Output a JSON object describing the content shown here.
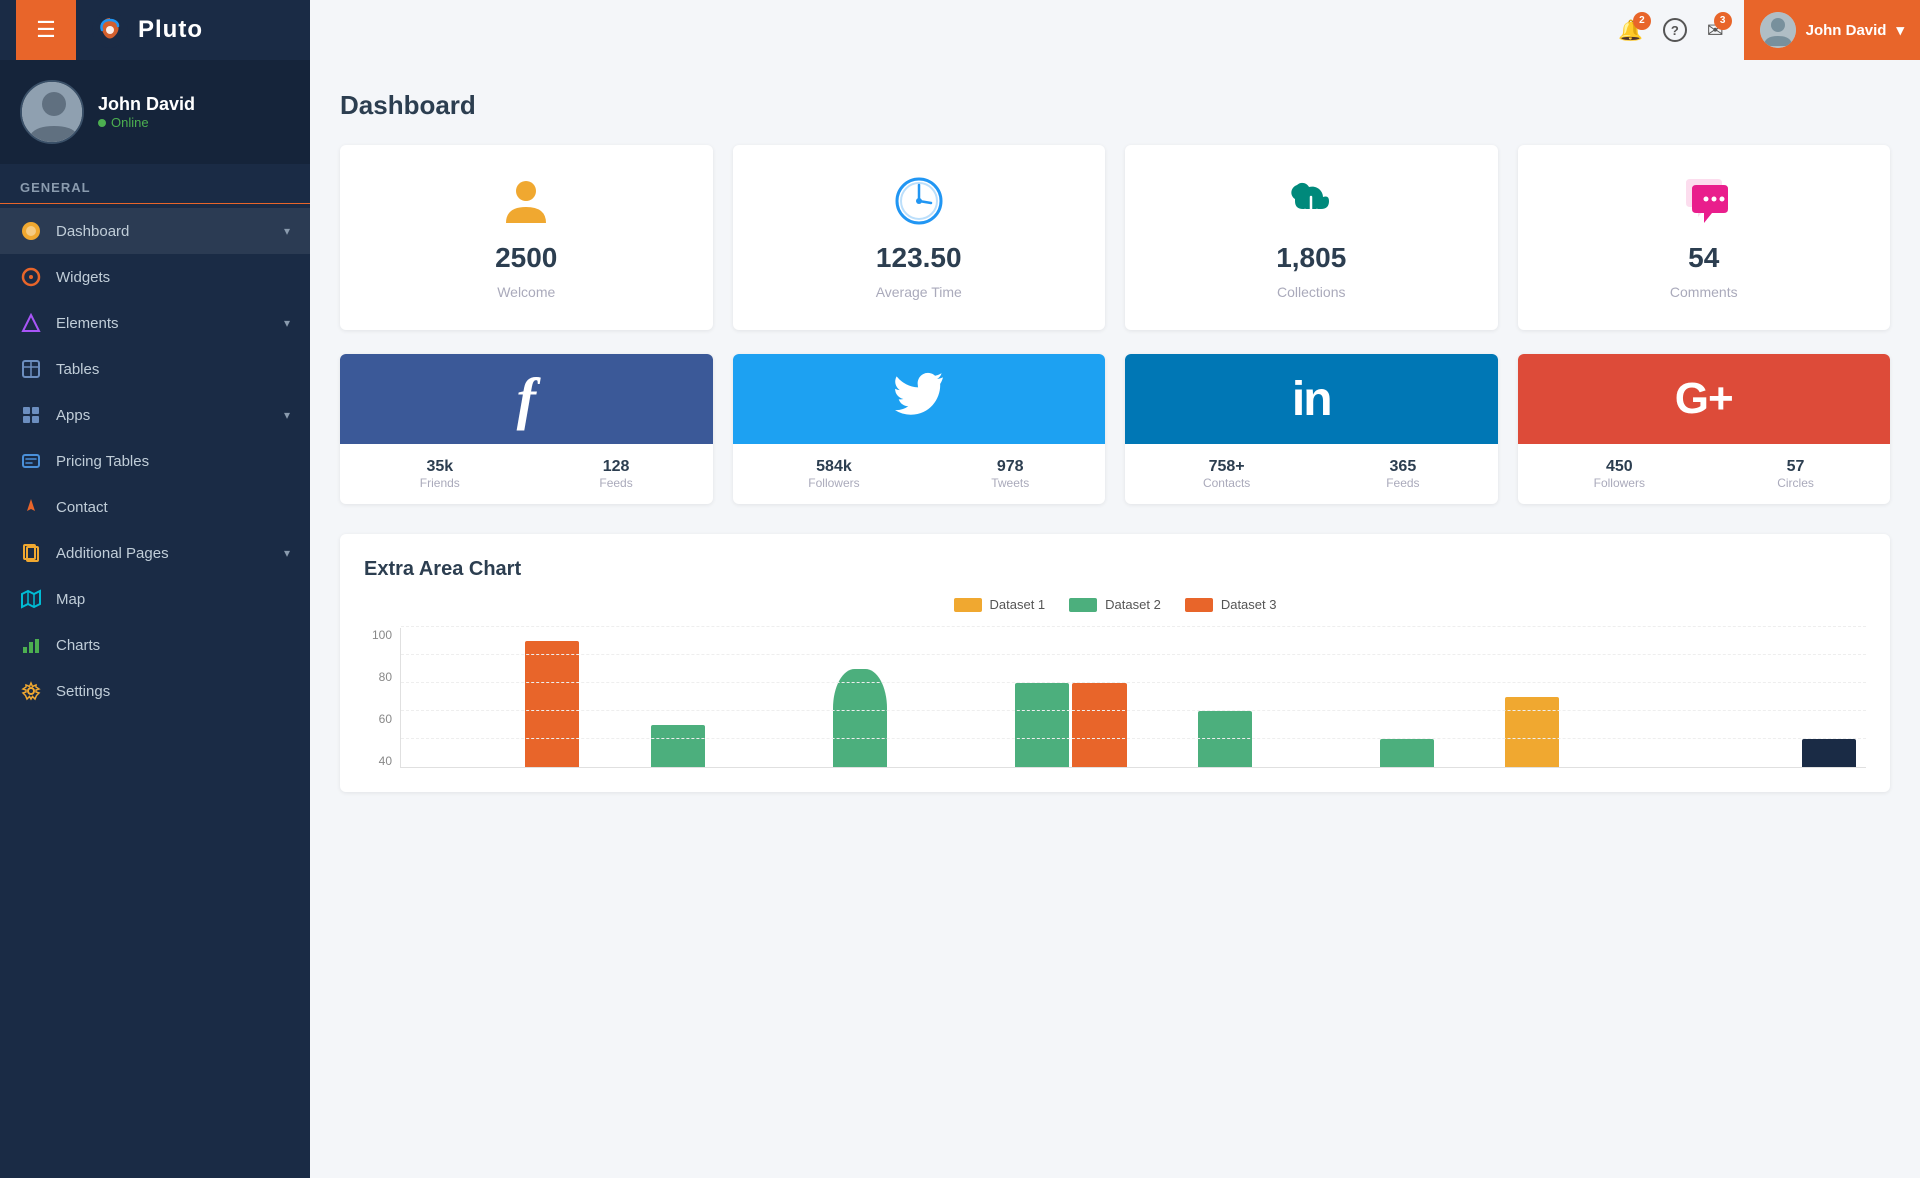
{
  "header": {
    "hamburger_label": "☰",
    "logo_text": "Pluto",
    "notification_count": "2",
    "message_count": "3",
    "user_name": "John David",
    "dropdown_arrow": "▾"
  },
  "sidebar": {
    "profile": {
      "name": "John David",
      "status": "Online"
    },
    "section_label": "General",
    "items": [
      {
        "id": "dashboard",
        "label": "Dashboard",
        "icon": "🎨",
        "has_arrow": true
      },
      {
        "id": "widgets",
        "label": "Widgets",
        "icon": "⭕",
        "has_arrow": false
      },
      {
        "id": "elements",
        "label": "Elements",
        "icon": "💎",
        "has_arrow": true
      },
      {
        "id": "tables",
        "label": "Tables",
        "icon": "⊞",
        "has_arrow": false
      },
      {
        "id": "apps",
        "label": "Apps",
        "icon": "🔲",
        "has_arrow": true
      },
      {
        "id": "pricing-tables",
        "label": "Pricing Tables",
        "icon": "💼",
        "has_arrow": false
      },
      {
        "id": "contact",
        "label": "Contact",
        "icon": "📌",
        "has_arrow": false
      },
      {
        "id": "additional-pages",
        "label": "Additional Pages",
        "icon": "📋",
        "has_arrow": true
      },
      {
        "id": "map",
        "label": "Map",
        "icon": "🗺",
        "has_arrow": false
      },
      {
        "id": "charts",
        "label": "Charts",
        "icon": "📊",
        "has_arrow": false
      },
      {
        "id": "settings",
        "label": "Settings",
        "icon": "⚙",
        "has_arrow": false
      }
    ]
  },
  "main": {
    "page_title": "Dashboard",
    "stat_cards": [
      {
        "id": "welcome",
        "value": "2500",
        "label": "Welcome",
        "icon_type": "person",
        "color": "#f0a830"
      },
      {
        "id": "average-time",
        "value": "123.50",
        "label": "Average Time",
        "icon_type": "clock",
        "color": "#2196f3"
      },
      {
        "id": "collections",
        "value": "1,805",
        "label": "Collections",
        "icon_type": "cloud",
        "color": "#00897b"
      },
      {
        "id": "comments",
        "value": "54",
        "label": "Comments",
        "icon_type": "chat",
        "color": "#e91e8c"
      }
    ],
    "social_cards": [
      {
        "id": "facebook",
        "bg_color": "#3b5998",
        "symbol": "f",
        "font_style": "italic",
        "stats": [
          {
            "value": "35k",
            "label": "Friends"
          },
          {
            "value": "128",
            "label": "Feeds"
          }
        ]
      },
      {
        "id": "twitter",
        "bg_color": "#1da1f2",
        "symbol": "🐦",
        "font_style": "normal",
        "stats": [
          {
            "value": "584k",
            "label": "Followers"
          },
          {
            "value": "978",
            "label": "Tweets"
          }
        ]
      },
      {
        "id": "linkedin",
        "bg_color": "#0077b5",
        "symbol": "in",
        "font_style": "normal",
        "stats": [
          {
            "value": "758+",
            "label": "Contacts"
          },
          {
            "value": "365",
            "label": "Feeds"
          }
        ]
      },
      {
        "id": "googleplus",
        "bg_color": "#dd4b39",
        "symbol": "G+",
        "font_style": "normal",
        "stats": [
          {
            "value": "450",
            "label": "Followers"
          },
          {
            "value": "57",
            "label": "Circles"
          }
        ]
      }
    ],
    "chart": {
      "title": "Extra Area Chart",
      "legend": [
        {
          "label": "Dataset 1",
          "color": "#f0a830"
        },
        {
          "label": "Dataset 2",
          "color": "#4caf7d"
        },
        {
          "label": "Dataset 3",
          "color": "#e8652a"
        }
      ],
      "y_axis": [
        "100",
        "80",
        "60",
        "40"
      ],
      "bars": [
        {
          "d1": 0,
          "d2": 0,
          "d3": 90
        },
        {
          "d1": 0,
          "d2": 30,
          "d3": 0
        },
        {
          "d1": 0,
          "d2": 70,
          "d3": 0
        },
        {
          "d1": 0,
          "d2": 60,
          "d3": 60
        },
        {
          "d1": 0,
          "d2": 40,
          "d3": 0
        },
        {
          "d1": 0,
          "d2": 20,
          "d3": 0
        },
        {
          "d1": 50,
          "d2": 0,
          "d3": 0
        },
        {
          "d1": 0,
          "d2": 0,
          "d3": 20
        }
      ]
    }
  }
}
